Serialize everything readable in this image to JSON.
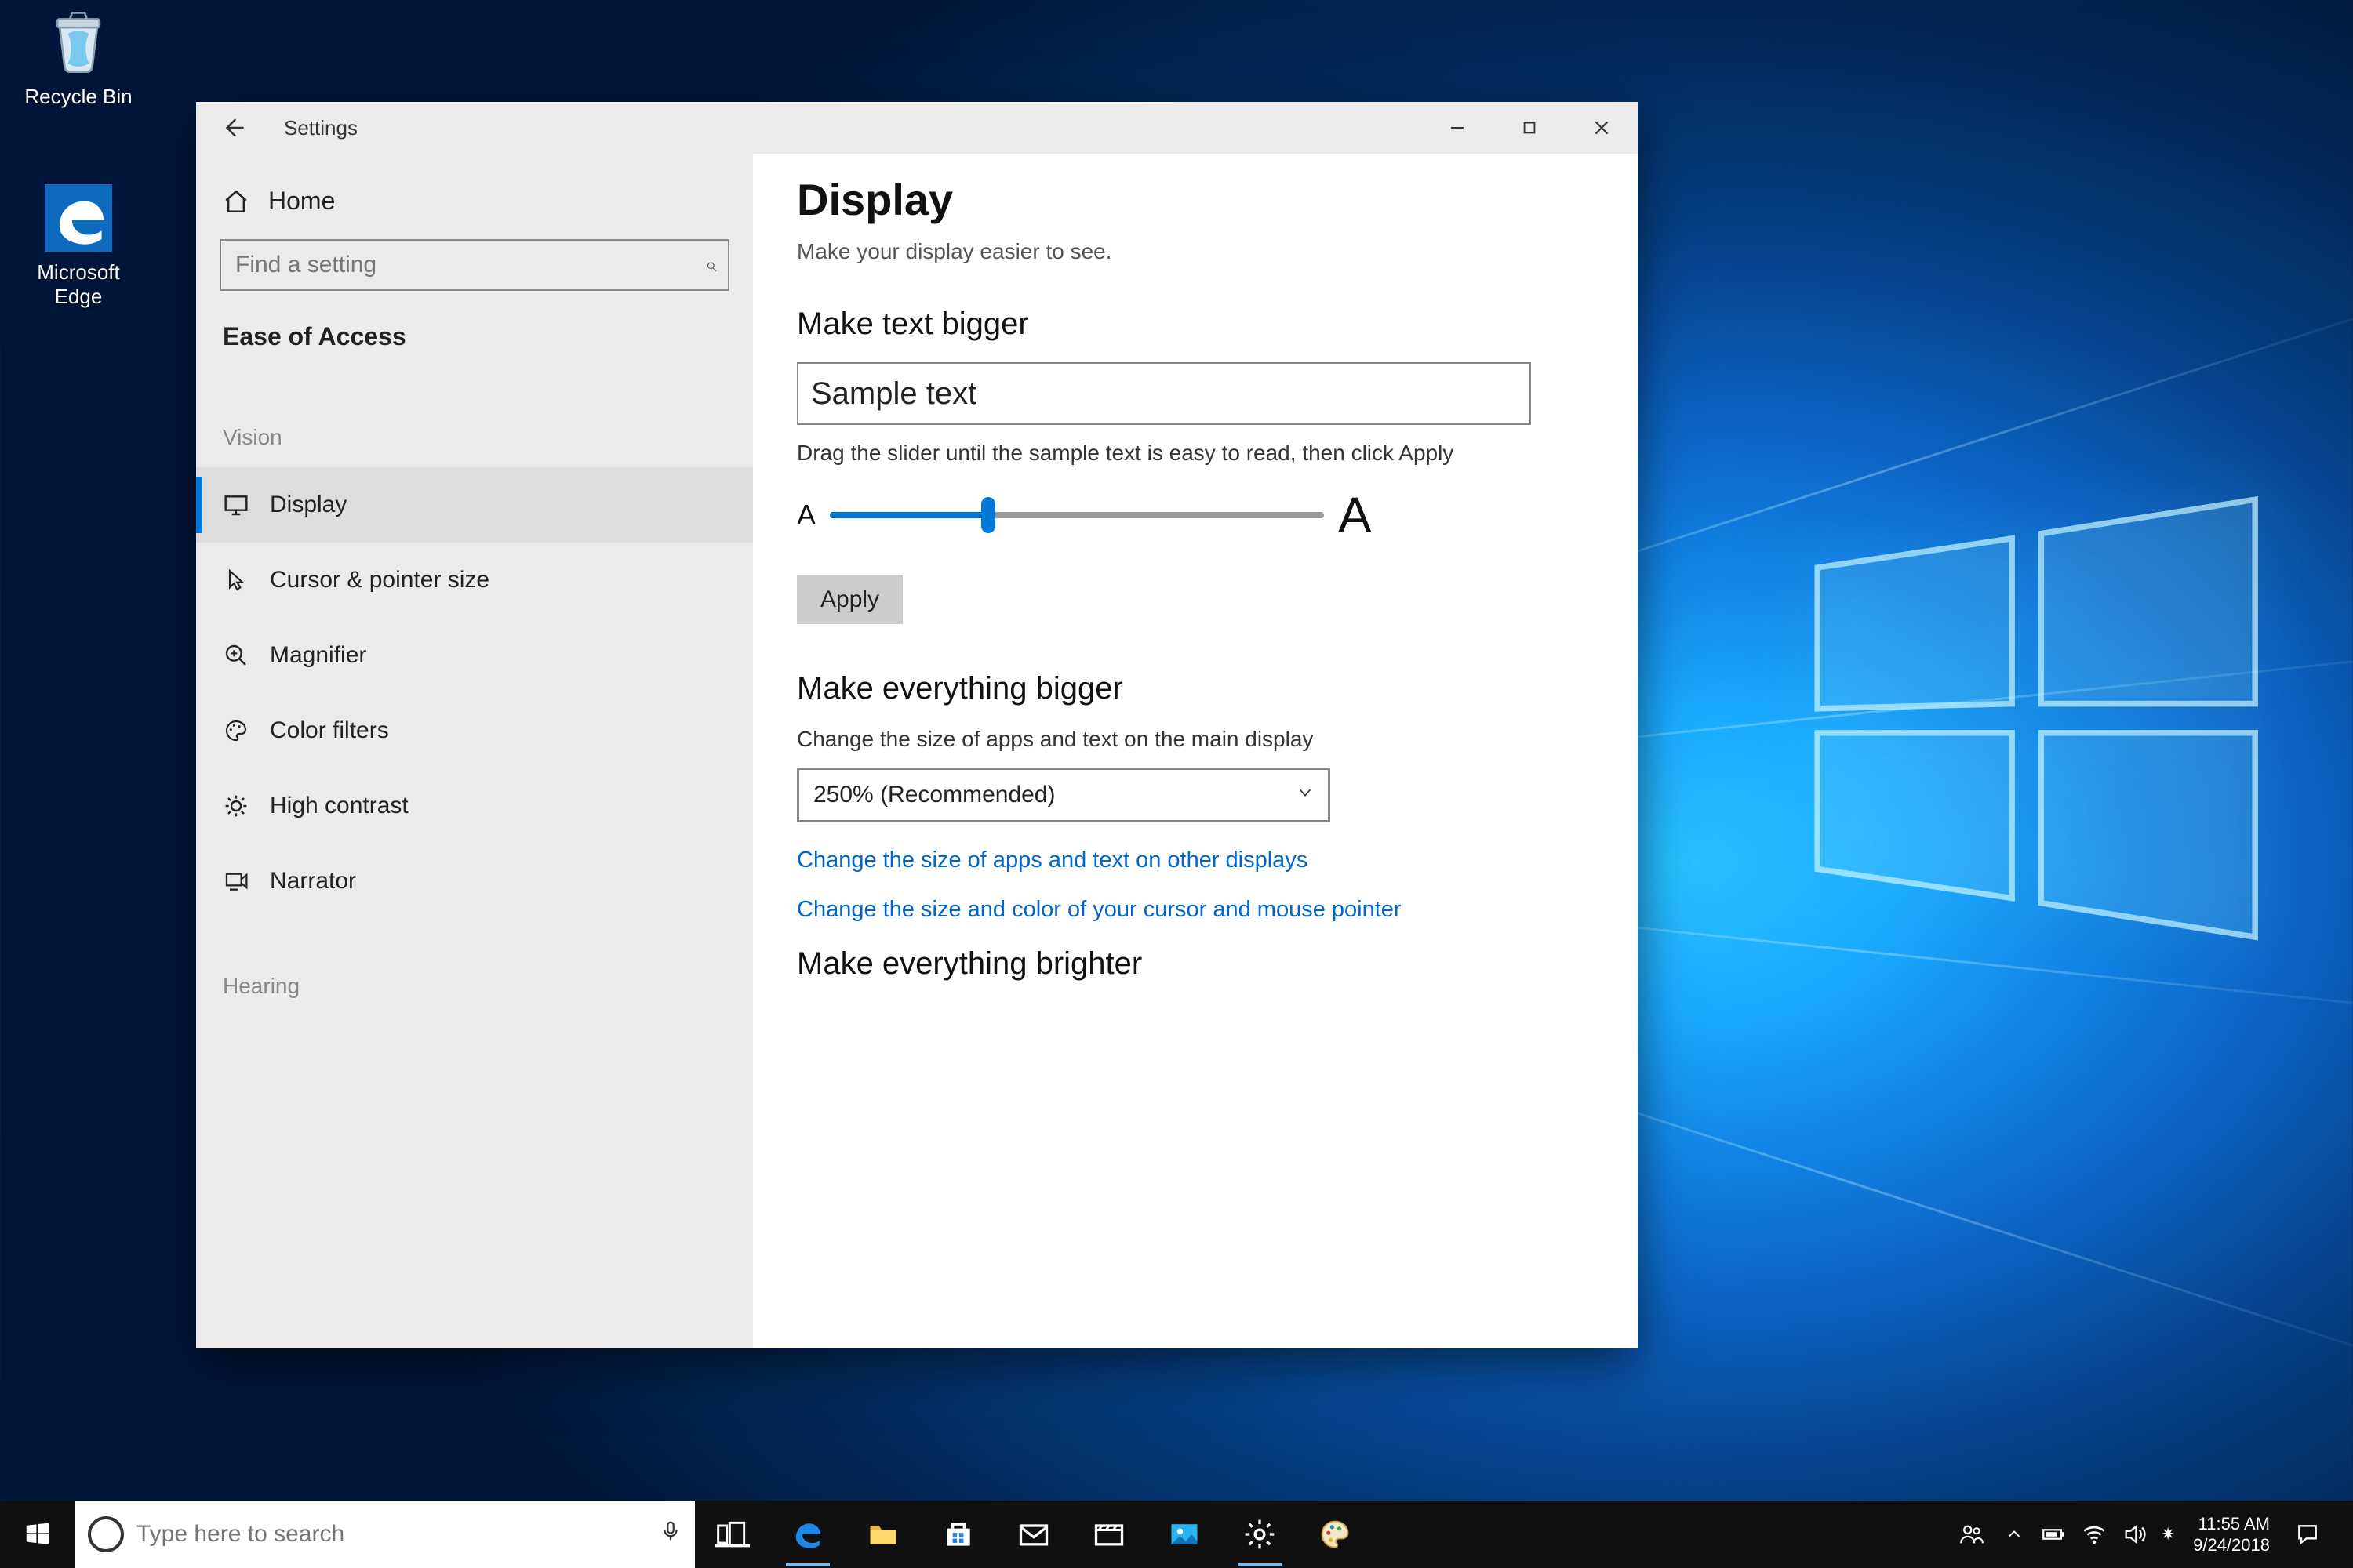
{
  "desktop": {
    "recycle_bin": "Recycle Bin",
    "edge": "Microsoft Edge"
  },
  "window": {
    "title": "Settings",
    "home": "Home",
    "search_placeholder": "Find a setting",
    "category": "Ease of Access",
    "groups": {
      "vision": "Vision",
      "hearing": "Hearing"
    },
    "nav": {
      "display": "Display",
      "cursor": "Cursor & pointer size",
      "magnifier": "Magnifier",
      "color_filters": "Color filters",
      "high_contrast": "High contrast",
      "narrator": "Narrator"
    }
  },
  "page": {
    "title": "Display",
    "subtitle": "Make your display easier to see.",
    "sec_text_bigger": "Make text bigger",
    "sample_text": "Sample text",
    "slider_help": "Drag the slider until the sample text is easy to read, then click Apply",
    "slider_small": "A",
    "slider_big": "A",
    "apply": "Apply",
    "sec_everything_bigger": "Make everything bigger",
    "scale_desc": "Change the size of apps and text on the main display",
    "scale_value": "250% (Recommended)",
    "link_other_displays": "Change the size of apps and text on other displays",
    "link_cursor": "Change the size and color of your cursor and mouse pointer",
    "sec_brighter": "Make everything brighter"
  },
  "taskbar": {
    "search_placeholder": "Type here to search",
    "time": "11:55 AM",
    "date": "9/24/2018"
  }
}
